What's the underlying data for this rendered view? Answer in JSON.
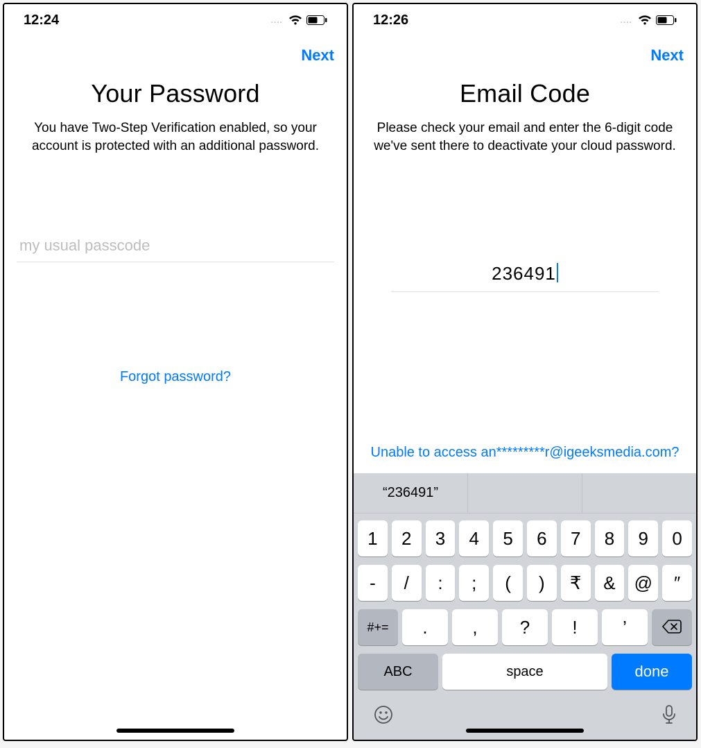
{
  "left": {
    "status": {
      "time": "12:24",
      "dots": "...."
    },
    "nav": {
      "next": "Next"
    },
    "title": "Your Password",
    "desc": "You have Two-Step Verification enabled, so your account is protected with an additional password.",
    "placeholder": "my usual passcode",
    "forgot": "Forgot password?"
  },
  "right": {
    "status": {
      "time": "12:26",
      "dots": "...."
    },
    "nav": {
      "next": "Next"
    },
    "title": "Email Code",
    "desc": "Please check your email and enter the 6-digit code we've sent there to deactivate your cloud password.",
    "code_value": "236491",
    "unable": "Unable to access an*********r@igeeksmedia.com?",
    "suggestion": "“236491”",
    "keyboard": {
      "row1": [
        "1",
        "2",
        "3",
        "4",
        "5",
        "6",
        "7",
        "8",
        "9",
        "0"
      ],
      "row2": [
        "-",
        "/",
        ":",
        ";",
        "(",
        ")",
        "₹",
        "&",
        "@",
        "″"
      ],
      "row3_shift": "#+=",
      "row3": [
        ".",
        ",",
        "?",
        "!",
        "’"
      ],
      "abc": "ABC",
      "space": "space",
      "done": "done"
    }
  }
}
